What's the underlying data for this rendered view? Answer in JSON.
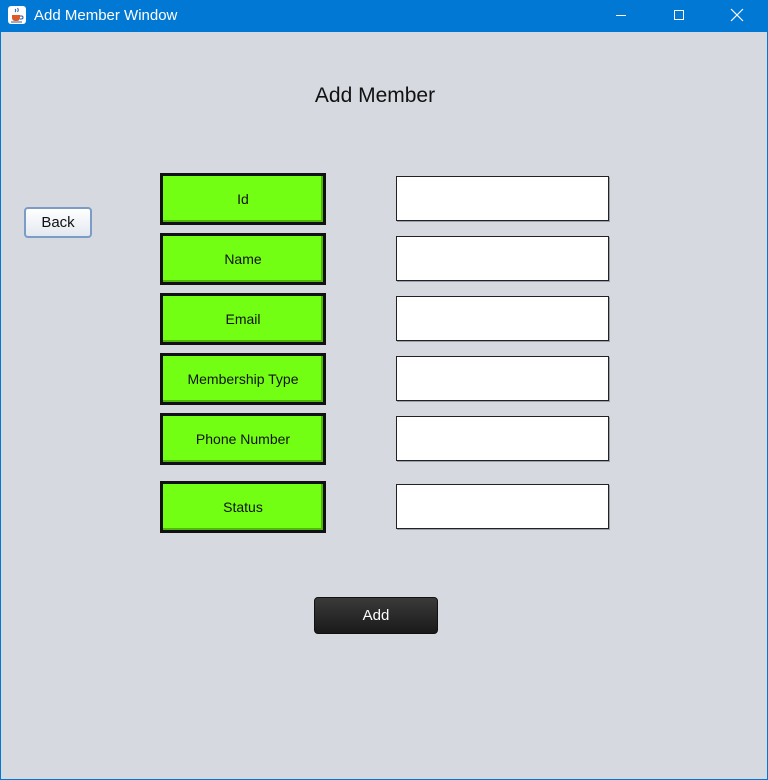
{
  "window": {
    "title": "Add Member Window",
    "accent_color": "#0078d4"
  },
  "page": {
    "heading": "Add Member",
    "back_label": "Back",
    "add_label": "Add",
    "background_color": "#d6d9e0",
    "label_color": "#73ff14"
  },
  "fields": [
    {
      "label": "Id",
      "value": ""
    },
    {
      "label": "Name",
      "value": ""
    },
    {
      "label": "Email",
      "value": ""
    },
    {
      "label": "Membership Type",
      "value": ""
    },
    {
      "label": "Phone Number",
      "value": ""
    },
    {
      "label": "Status",
      "value": ""
    }
  ],
  "icons": {
    "app": "java-cup-icon",
    "minimize": "minimize-icon",
    "maximize": "maximize-icon",
    "close": "close-icon"
  }
}
